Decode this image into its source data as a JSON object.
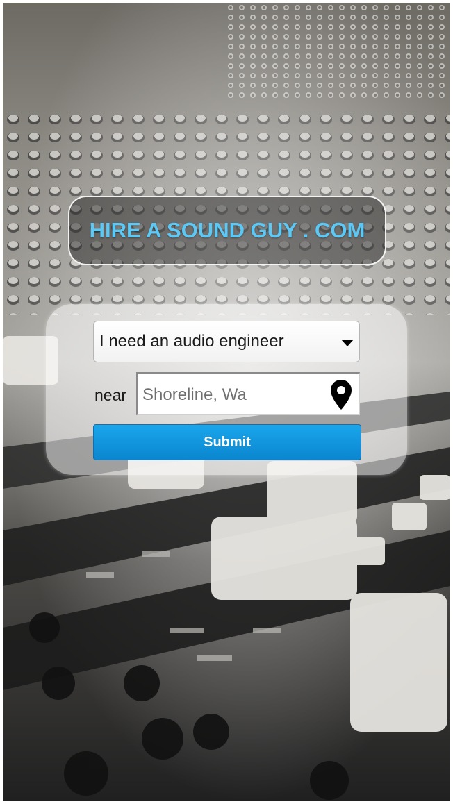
{
  "site": {
    "title": "HIRE A SOUND GUY . COM"
  },
  "search_form": {
    "service_select": {
      "value": "I need an audio engineer"
    },
    "near_label": "near",
    "location": {
      "value": "Shoreline, Wa"
    },
    "submit_label": "Submit"
  },
  "icons": {
    "dropdown": "chevron-down-icon",
    "location": "map-pin-icon"
  },
  "colors": {
    "title": "#5cc8f5",
    "submit": "#0a86cf"
  }
}
